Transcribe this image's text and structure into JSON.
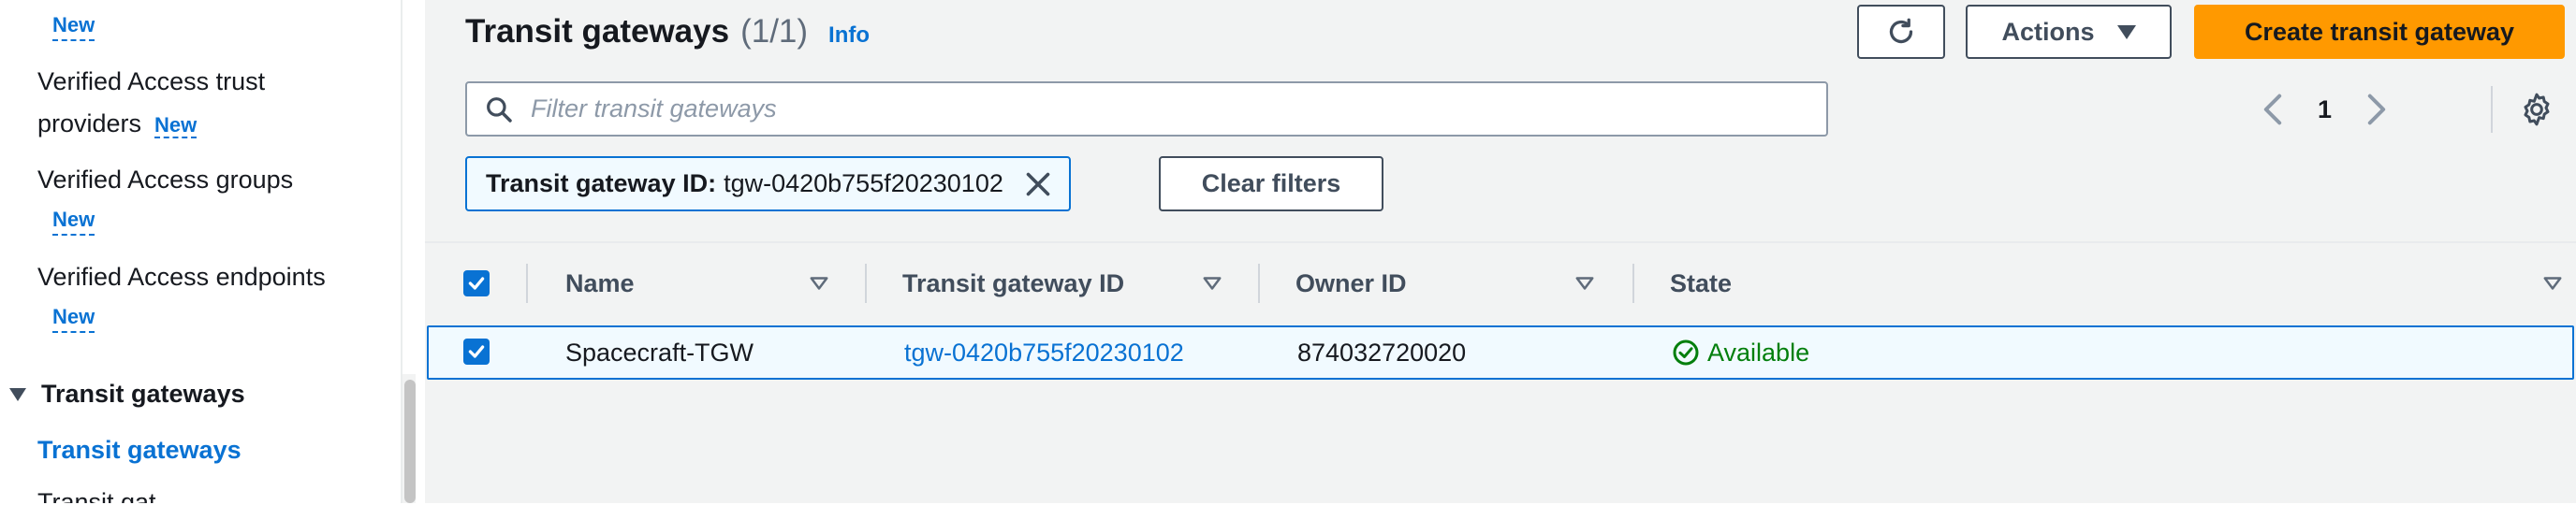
{
  "sidebar": {
    "items": [
      {
        "label": "",
        "badge": "New"
      },
      {
        "label_line1": "Verified Access trust",
        "label_line2": "providers",
        "badge": "New"
      },
      {
        "label": "Verified Access groups",
        "badge": "New"
      },
      {
        "label": "Verified Access endpoints",
        "badge": "New"
      }
    ],
    "section": "Transit gateways",
    "active_item": "Transit gateways",
    "cut_item": "Transit gat"
  },
  "header": {
    "title": "Transit gateways",
    "count": "(1/1)",
    "info": "Info",
    "actions_label": "Actions",
    "create_label": "Create transit gateway"
  },
  "search": {
    "placeholder": "Filter transit gateways",
    "value": ""
  },
  "pagination": {
    "current_page": "1"
  },
  "filter": {
    "token_label": "Transit gateway ID:",
    "token_value": "tgw-0420b755f20230102",
    "clear_label": "Clear filters"
  },
  "table": {
    "columns": [
      "Name",
      "Transit gateway ID",
      "Owner ID",
      "State"
    ],
    "rows": [
      {
        "name": "Spacecraft-TGW",
        "tgw_id": "tgw-0420b755f20230102",
        "owner_id": "874032720020",
        "state": "Available",
        "selected": true
      }
    ]
  },
  "colors": {
    "accent": "#0972d3",
    "primary_button": "#ff9900",
    "success": "#037f0c"
  },
  "icons": [
    "refresh-icon",
    "caret-down-icon",
    "search-icon",
    "chevron-left-icon",
    "chevron-right-icon",
    "gear-icon",
    "close-icon",
    "sort-icon",
    "check-icon",
    "status-success-icon"
  ]
}
